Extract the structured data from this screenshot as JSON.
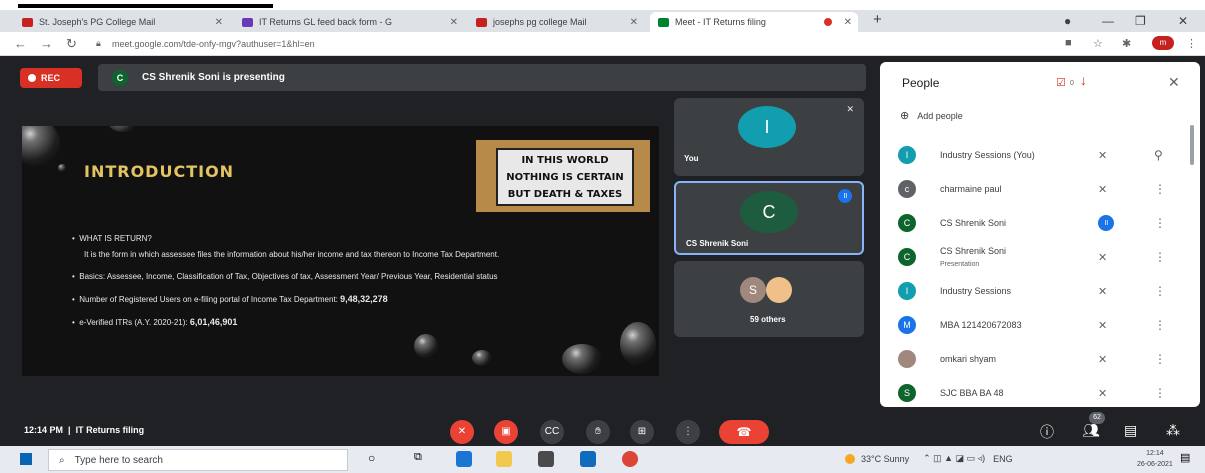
{
  "browser": {
    "tabs": [
      {
        "title": "St. Joseph's PG College Mail",
        "favicon_color": "#c5221f"
      },
      {
        "title": "IT Returns GL feed back form - G",
        "favicon_color": "#673ab7"
      },
      {
        "title": "josephs pg college Mail",
        "favicon_color": "#c5221f"
      },
      {
        "title": "Meet - IT Returns filing",
        "favicon_color": "#00832d"
      }
    ],
    "new_tab": "+",
    "url": "meet.google.com/tde-onfy-mgv?authuser=1&hl=en",
    "profile_initial": "m"
  },
  "meet": {
    "rec_label": "REC",
    "presenter_initial": "C",
    "presenting_text": "CS Shrenik Soni is presenting",
    "slide": {
      "title": "INTRODUCTION",
      "sign_lines": [
        "IN THIS WORLD",
        "NOTHING IS CERTAIN",
        "BUT DEATH & TAXES"
      ],
      "bullets": [
        {
          "text": "WHAT IS RETURN?"
        },
        {
          "text": "It is the form in which assessee files the information about his/her income and tax thereon to Income Tax Department."
        },
        {
          "text": "Basics: Assessee, Income, Classification of Tax, Objectives of tax, Assessment Year/ Previous Year, Residential status"
        },
        {
          "text": "Number of Registered Users on e-filing portal of Income Tax Department: ",
          "bold": "9,48,32,278"
        },
        {
          "text": "e-Verified ITRs  (A.Y. 2020-21): ",
          "bold": "6,01,46,901"
        }
      ]
    },
    "tiles": {
      "you": {
        "label": "You",
        "initial": "I",
        "color": "#129eaf"
      },
      "presenter": {
        "label": "CS Shrenik Soni",
        "initial": "C",
        "color": "#1e5c3f"
      },
      "others": {
        "label": "59 others",
        "initial": "S",
        "color": "#a1887f"
      }
    },
    "meeting_time": "12:14 PM",
    "meeting_sep": "|",
    "meeting_name": "IT Returns filing",
    "participant_count": "62",
    "people_badge": "0"
  },
  "people_panel": {
    "title": "People",
    "add_people": "Add people",
    "participants": [
      {
        "name": "Industry Sessions (You)",
        "initial": "I",
        "color": "#129eaf"
      },
      {
        "name": "charmaine paul",
        "initial": "c",
        "color": "#5f6368"
      },
      {
        "name": "CS Shrenik Soni",
        "initial": "C",
        "color": "#0d652d"
      },
      {
        "name": "CS Shrenik Soni",
        "sub": "Presentation",
        "initial": "C",
        "color": "#0d652d"
      },
      {
        "name": "Industry Sessions",
        "initial": "I",
        "color": "#129eaf"
      },
      {
        "name": "MBA 121420672083",
        "initial": "M",
        "color": "#1a73e8"
      },
      {
        "name": "omkari shyam",
        "initial": "",
        "color": "#a1887f"
      },
      {
        "name": "SJC BBA BA 48",
        "initial": "S",
        "color": "#0d652d"
      }
    ]
  },
  "taskbar": {
    "search_placeholder": "Type here to search",
    "weather": "33°C  Sunny",
    "lang": "ENG",
    "time": "12:14",
    "date": "26-06-2021"
  }
}
